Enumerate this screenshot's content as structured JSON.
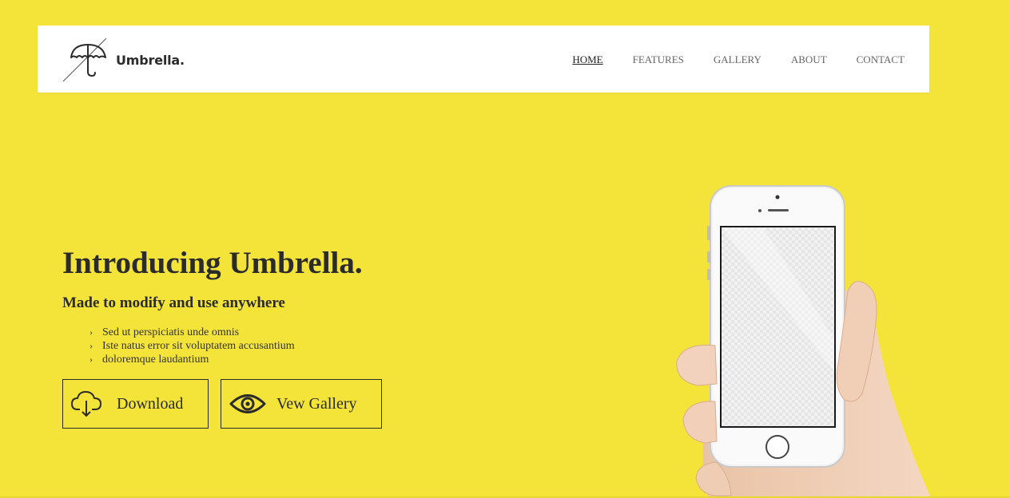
{
  "brand": {
    "name": "Umbrella."
  },
  "nav": {
    "items": [
      {
        "label": "HOME",
        "active": true
      },
      {
        "label": "FEATURES",
        "active": false
      },
      {
        "label": "GALLERY",
        "active": false
      },
      {
        "label": "ABOUT",
        "active": false
      },
      {
        "label": "CONTACT",
        "active": false
      }
    ]
  },
  "hero": {
    "title_prefix": "Introducing ",
    "title_bold": "Umbrella.",
    "subtitle": "Made to modify and use anywhere",
    "features": [
      "Sed ut perspiciatis unde omnis",
      "Iste natus error sit voluptatem accusantium",
      "doloremque laudantium"
    ],
    "buttons": {
      "download": {
        "label": "Download",
        "icon": "cloud-download-icon"
      },
      "gallery": {
        "label": "Vew Gallery",
        "icon": "eye-icon"
      }
    }
  },
  "colors": {
    "background": "#f4e43a",
    "header": "#ffffff",
    "text": "#2b2b2b"
  }
}
